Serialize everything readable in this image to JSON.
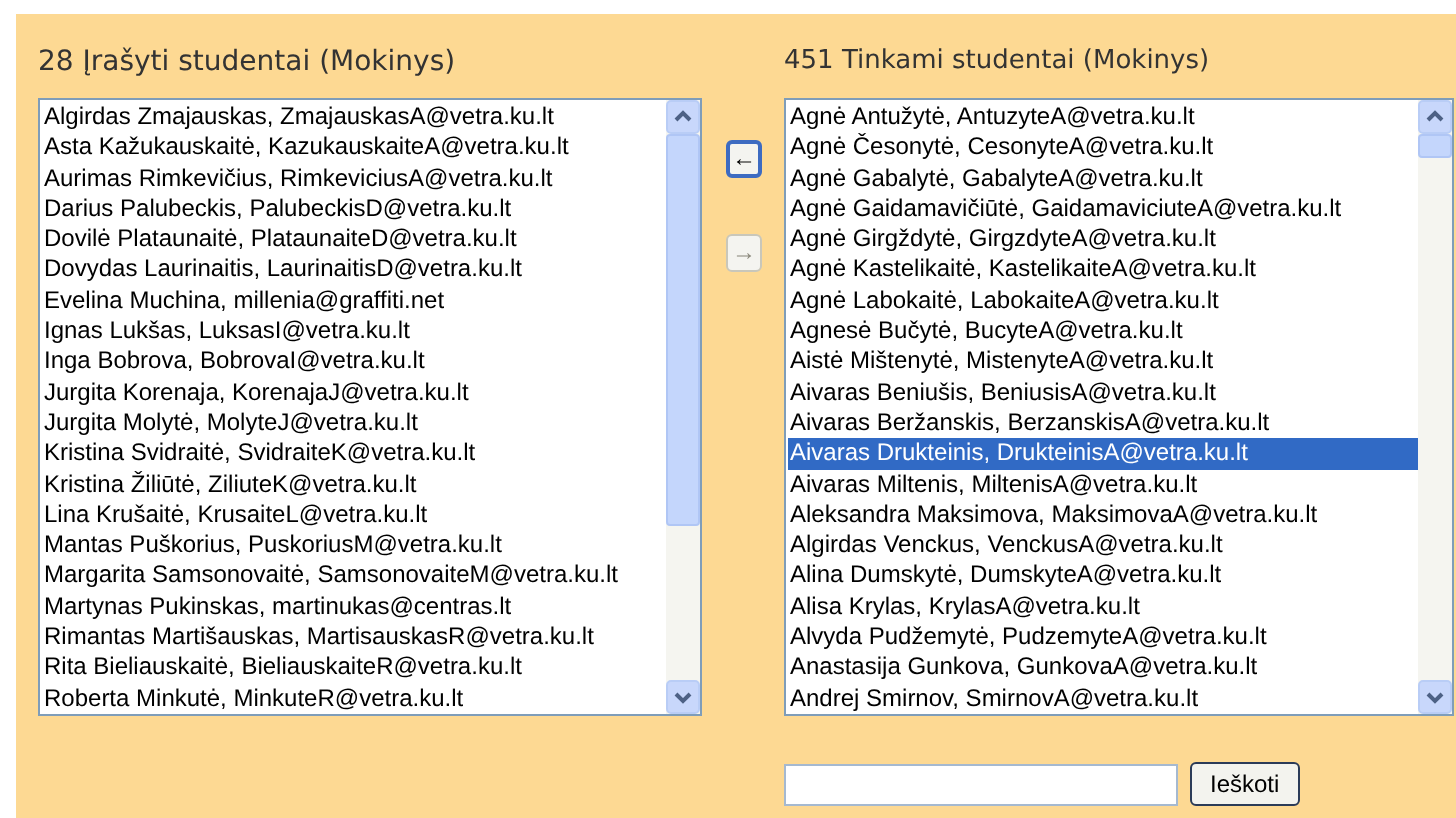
{
  "enrolled": {
    "heading": "28 Įrašyti studentai (Mokinys)",
    "items": [
      {
        "label": "Algirdas Zmajauskas, ZmajauskasA@vetra.ku.lt",
        "selected": false
      },
      {
        "label": "Asta Kažukauskaitė, KazukauskaiteA@vetra.ku.lt",
        "selected": false
      },
      {
        "label": "Aurimas Rimkevičius, RimkeviciusA@vetra.ku.lt",
        "selected": false
      },
      {
        "label": "Darius Palubeckis, PalubeckisD@vetra.ku.lt",
        "selected": false
      },
      {
        "label": "Dovilė Plataunaitė, PlataunaiteD@vetra.ku.lt",
        "selected": false
      },
      {
        "label": "Dovydas Laurinaitis, LaurinaitisD@vetra.ku.lt",
        "selected": false
      },
      {
        "label": "Evelina Muchina, millenia@graffiti.net",
        "selected": false
      },
      {
        "label": "Ignas Lukšas, LuksasI@vetra.ku.lt",
        "selected": false
      },
      {
        "label": "Inga Bobrova, BobrovaI@vetra.ku.lt",
        "selected": false
      },
      {
        "label": "Jurgita Korenaja, KorenajaJ@vetra.ku.lt",
        "selected": false
      },
      {
        "label": "Jurgita Molytė, MolyteJ@vetra.ku.lt",
        "selected": false
      },
      {
        "label": "Kristina Svidraitė, SvidraiteK@vetra.ku.lt",
        "selected": false
      },
      {
        "label": "Kristina Žiliūtė, ZiliuteK@vetra.ku.lt",
        "selected": false
      },
      {
        "label": "Lina Krušaitė, KrusaiteL@vetra.ku.lt",
        "selected": false
      },
      {
        "label": "Mantas Puškorius, PuskoriusM@vetra.ku.lt",
        "selected": false
      },
      {
        "label": "Margarita Samsonovaitė, SamsonovaiteM@vetra.ku.lt",
        "selected": false
      },
      {
        "label": "Martynas Pukinskas, martinukas@centras.lt",
        "selected": false
      },
      {
        "label": "Rimantas Martišauskas, MartisauskasR@vetra.ku.lt",
        "selected": false
      },
      {
        "label": "Rita Bieliauskaitė, BieliauskaiteR@vetra.ku.lt",
        "selected": false
      },
      {
        "label": "Roberta Minkutė, MinkuteR@vetra.ku.lt",
        "selected": false
      }
    ]
  },
  "move_buttons": [
    {
      "label": "←",
      "disabled": false
    },
    {
      "label": "→",
      "disabled": true
    }
  ],
  "available": {
    "heading": "451 Tinkami studentai (Mokinys)",
    "items": [
      {
        "label": "Agnė Antužytė, AntuzyteA@vetra.ku.lt",
        "selected": false
      },
      {
        "label": "Agnė Česonytė, CesonyteA@vetra.ku.lt",
        "selected": false
      },
      {
        "label": "Agnė Gabalytė, GabalyteA@vetra.ku.lt",
        "selected": false
      },
      {
        "label": "Agnė Gaidamavičiūtė, GaidamaviciuteA@vetra.ku.lt",
        "selected": false
      },
      {
        "label": "Agnė Girgždytė, GirgzdyteA@vetra.ku.lt",
        "selected": false
      },
      {
        "label": "Agnė Kastelikaitė, KastelikaiteA@vetra.ku.lt",
        "selected": false
      },
      {
        "label": "Agnė Labokaitė, LabokaiteA@vetra.ku.lt",
        "selected": false
      },
      {
        "label": "Agnesė Bučytė, BucyteA@vetra.ku.lt",
        "selected": false
      },
      {
        "label": "Aistė Mištenytė, MistenyteA@vetra.ku.lt",
        "selected": false
      },
      {
        "label": "Aivaras Beniušis, BeniusisA@vetra.ku.lt",
        "selected": false
      },
      {
        "label": "Aivaras Beržanskis, BerzanskisA@vetra.ku.lt",
        "selected": false
      },
      {
        "label": "Aivaras Drukteinis, DrukteinisA@vetra.ku.lt",
        "selected": true
      },
      {
        "label": "Aivaras Miltenis, MiltenisA@vetra.ku.lt",
        "selected": false
      },
      {
        "label": "Aleksandra Maksimova, MaksimovaA@vetra.ku.lt",
        "selected": false
      },
      {
        "label": "Algirdas Venckus, VenckusA@vetra.ku.lt",
        "selected": false
      },
      {
        "label": "Alina Dumskytė, DumskyteA@vetra.ku.lt",
        "selected": false
      },
      {
        "label": "Alisa Krylas, KrylasA@vetra.ku.lt",
        "selected": false
      },
      {
        "label": "Alvyda Pudžemytė, PudzemyteA@vetra.ku.lt",
        "selected": false
      },
      {
        "label": "Anastasija Gunkova, GunkovaA@vetra.ku.lt",
        "selected": false
      },
      {
        "label": "Andrej Smirnov, SmirnovA@vetra.ku.lt",
        "selected": false
      }
    ]
  },
  "search": {
    "button": "Ieškoti"
  }
}
